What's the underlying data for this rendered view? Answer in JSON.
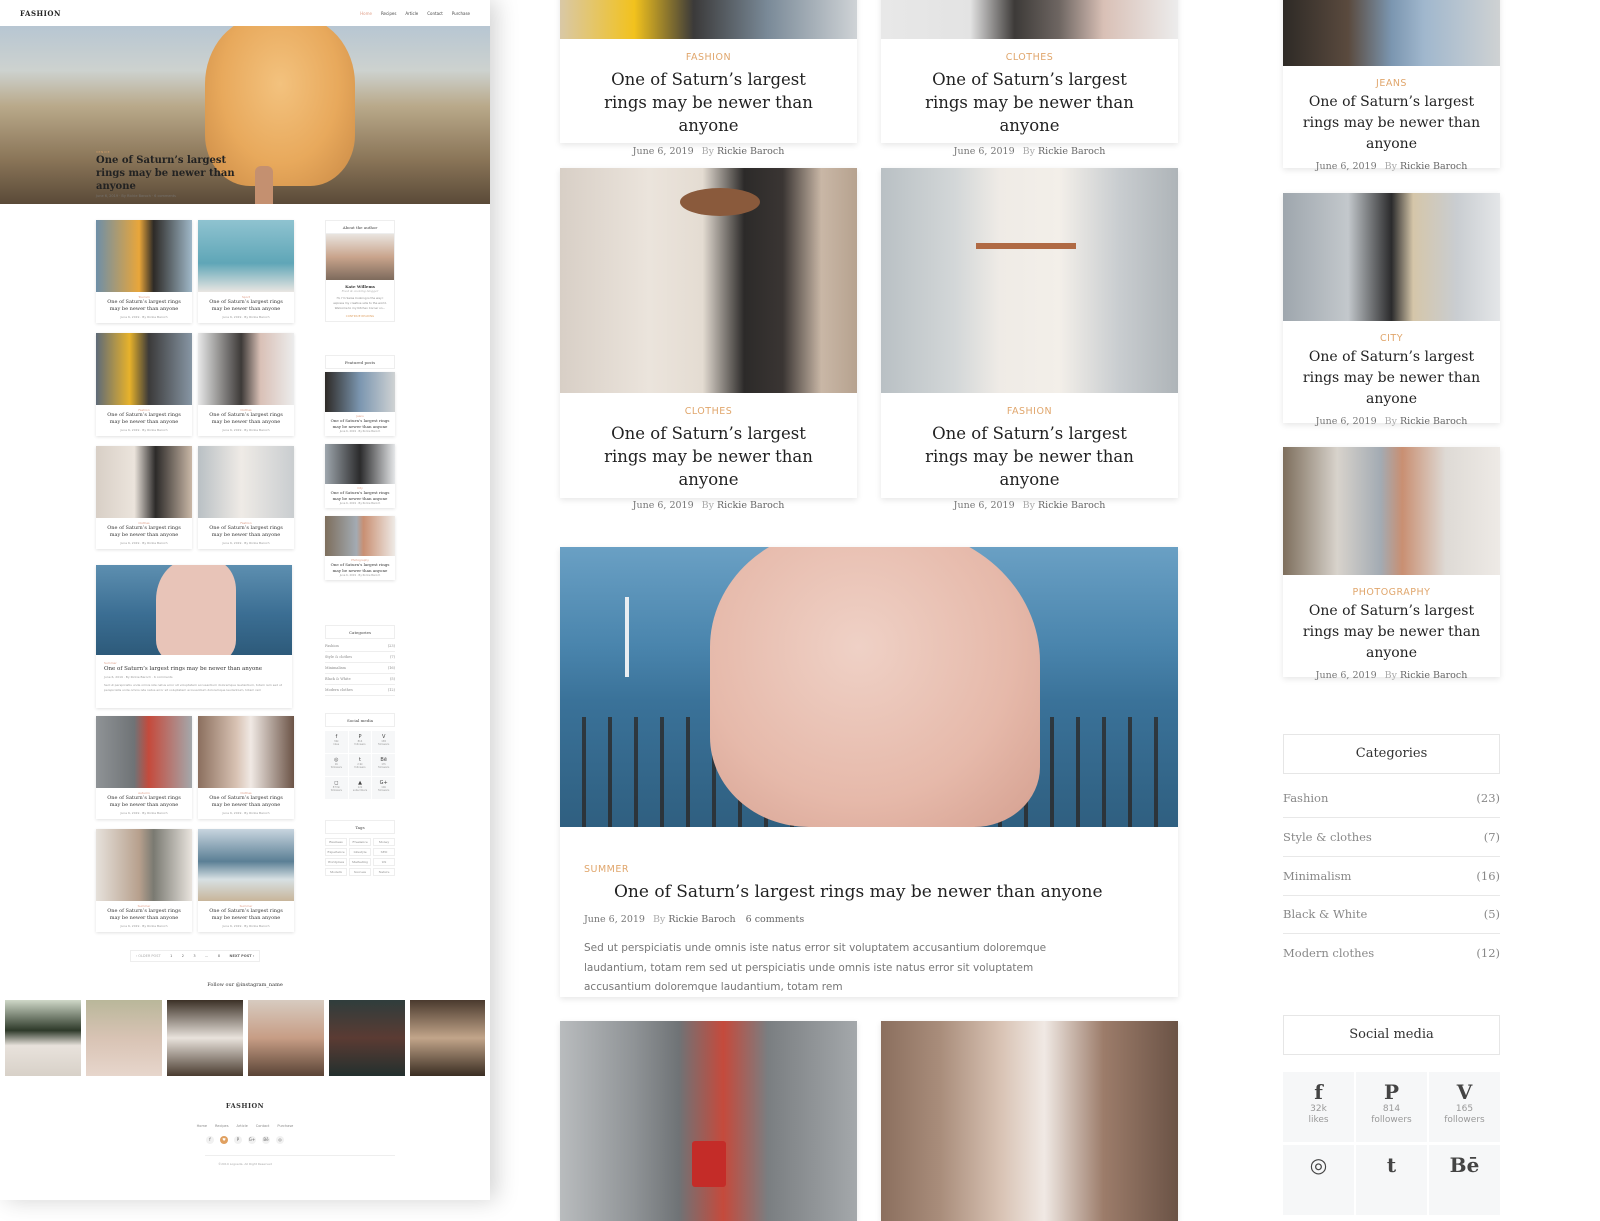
{
  "mini": {
    "logo": "FASHION",
    "menu": [
      "Home",
      "Recipes",
      "Article",
      "Contact",
      "Purchase"
    ],
    "hero": {
      "category": "VENICE",
      "title": "One of Saturn’s largest rings may be newer than anyone",
      "meta": "June 6, 2019  ·  By Rickie Baroch  ·  6 comments"
    },
    "cards": [
      {
        "category": "Tourism",
        "title": "One of Saturn’s largest rings may be newer than anyone",
        "meta": "June 6, 2019 · By Rickie Baroch"
      },
      {
        "category": "Sport",
        "title": "One of Saturn’s largest rings may be newer than anyone",
        "meta": "June 6, 2019 · By Rickie Baroch"
      },
      {
        "category": "Fashion",
        "title": "One of Saturn’s largest rings may be newer than anyone",
        "meta": "June 6, 2019 · By Rickie Baroch"
      },
      {
        "category": "Clothes",
        "title": "One of Saturn’s largest rings may be newer than anyone",
        "meta": "June 6, 2019 · By Rickie Baroch"
      },
      {
        "category": "Clothes",
        "title": "One of Saturn’s largest rings may be newer than anyone",
        "meta": "June 6, 2019 · By Rickie Baroch"
      },
      {
        "category": "Fashion",
        "title": "One of Saturn’s largest rings may be newer than anyone",
        "meta": "June 6, 2019 · By Rickie Baroch"
      },
      {
        "category": "Autumn",
        "title": "One of Saturn’s largest rings may be newer than anyone",
        "meta": "June 6, 2019 · By Rickie Baroch"
      },
      {
        "category": "Clothes",
        "title": "One of Saturn’s largest rings may be newer than anyone",
        "meta": "June 6, 2019 · By Rickie Baroch"
      },
      {
        "category": "Summer",
        "title": "One of Saturn’s largest rings may be newer than anyone",
        "meta": "June 6, 2019 · By Rickie Baroch"
      },
      {
        "category": "Summer",
        "title": "One of Saturn’s largest rings may be newer than anyone",
        "meta": "June 6, 2019 · By Rickie Baroch"
      }
    ],
    "wide": {
      "category": "Summer",
      "title": "One of Saturn’s largest rings may be newer than anyone",
      "meta": "June 6, 2019 · By Rickie Baroch · 6 comments",
      "excerpt": "Sed ut perspiciatis unde omnis iste natus error sit voluptatem accusantium doloremque laudantium, totam rem sed ut perspiciatis unde omnis iste natus error sit voluptatem accusantium doloremque laudantium, totam rem"
    },
    "about": {
      "heading": "About the author",
      "name": "Kate Willems",
      "role": "Food & cooking blogger",
      "bio": "Hi, I'm Swiss Cooking is the way I express my creative side to the world. Welcome to my Kitchen Corner on...",
      "link": "CONTINUE READING"
    },
    "featured": {
      "heading": "Featured posts",
      "items": [
        {
          "category": "Jeans",
          "title": "One of Saturn’s largest rings may be newer than anyone",
          "meta": "June 6, 2019 · By Rickie Baroch"
        },
        {
          "category": "City",
          "title": "One of Saturn’s largest rings may be newer than anyone",
          "meta": "June 6, 2019 · By Rickie Baroch"
        },
        {
          "category": "Photography",
          "title": "One of Saturn’s largest rings may be newer than anyone",
          "meta": "June 6, 2019 · By Rickie Baroch"
        }
      ]
    },
    "categories_heading": "Categories",
    "social_heading": "Social media",
    "social": [
      {
        "icon": "f",
        "count": "32k",
        "label": "likes"
      },
      {
        "icon": "P",
        "count": "814",
        "label": "followers"
      },
      {
        "icon": "V",
        "count": "165",
        "label": "followers"
      },
      {
        "icon": "◎",
        "count": "1K",
        "label": "followers"
      },
      {
        "icon": "t",
        "count": "2.9k",
        "label": "followers"
      },
      {
        "icon": "Bē",
        "count": "17k",
        "label": "followers"
      },
      {
        "icon": "◻",
        "count": "87mk",
        "label": "followers"
      },
      {
        "icon": "▲",
        "count": "12k",
        "label": "subscribers"
      },
      {
        "icon": "G+",
        "count": "14K",
        "label": "followers"
      }
    ],
    "tags_heading": "Tags",
    "tags": [
      "Business",
      "Freelance",
      "Money",
      "Experience",
      "Lifestyle",
      "SEO",
      "Wordpress",
      "Marketing",
      "UX",
      "Modern",
      "Success",
      "Nature"
    ],
    "pager": {
      "older": "‹ OLDER POST",
      "pages": [
        "1",
        "2",
        "3",
        "...",
        "8"
      ],
      "newer": "NEXT POST ›"
    },
    "instagram_title": "Follow our @instagram_name",
    "footer": {
      "logo": "FASHION",
      "menu": [
        "Home",
        "Recipes",
        "Article",
        "Contact",
        "Purchase"
      ],
      "social": [
        "f",
        "♥",
        "P",
        "G+",
        "Bē",
        "◎"
      ],
      "copyright": "©2019 Logoeda. All Right Reserved"
    }
  },
  "main": {
    "top_cards": [
      {
        "category": "FASHION",
        "title": "One of Saturn’s largest rings may be newer than anyone",
        "date": "June 6, 2019",
        "by": "By",
        "author": "Rickie Baroch"
      },
      {
        "category": "CLOTHES",
        "title": "One of Saturn’s largest rings may be newer than anyone",
        "date": "June 6, 2019",
        "by": "By",
        "author": "Rickie Baroch"
      }
    ],
    "mid_cards": [
      {
        "category": "CLOTHES",
        "title": "One of Saturn’s largest rings may be newer than anyone",
        "date": "June 6, 2019",
        "by": "By",
        "author": "Rickie Baroch"
      },
      {
        "category": "FASHION",
        "title": "One of Saturn’s largest rings may be newer than anyone",
        "date": "June 6, 2019",
        "by": "By",
        "author": "Rickie Baroch"
      }
    ],
    "wide": {
      "category": "SUMMER",
      "title": "One of Saturn’s largest rings may be newer than anyone",
      "date": "June 6, 2019",
      "by": "By",
      "author": "Rickie Baroch",
      "comments": "6 comments",
      "excerpt": "Sed ut perspiciatis unde omnis iste natus error sit voluptatem accusantium doloremque laudantium, totam rem sed ut perspiciatis unde omnis iste natus error sit voluptatem accusantium doloremque laudantium, totam rem"
    }
  },
  "sidebar": {
    "featured": [
      {
        "category": "JEANS",
        "title": "One of Saturn’s largest rings may be newer than anyone",
        "date": "June 6, 2019",
        "by": "By",
        "author": "Rickie Baroch"
      },
      {
        "category": "CITY",
        "title": "One of Saturn’s largest rings may be newer than anyone",
        "date": "June 6, 2019",
        "by": "By",
        "author": "Rickie Baroch"
      },
      {
        "category": "PHOTOGRAPHY",
        "title": "One of Saturn’s largest rings may be newer than anyone",
        "date": "June 6, 2019",
        "by": "By",
        "author": "Rickie Baroch"
      }
    ],
    "categories_heading": "Categories",
    "categories": [
      {
        "name": "Fashion",
        "count": "(23)"
      },
      {
        "name": "Style & clothes",
        "count": "(7)"
      },
      {
        "name": "Minimalism",
        "count": "(16)"
      },
      {
        "name": "Black & White",
        "count": "(5)"
      },
      {
        "name": "Modern clothes",
        "count": "(12)"
      }
    ],
    "social_heading": "Social media",
    "social": [
      {
        "icon": "f",
        "count": "32k",
        "label": "likes"
      },
      {
        "icon": "P",
        "count": "814",
        "label": "followers"
      },
      {
        "icon": "V",
        "count": "165",
        "label": "followers"
      },
      {
        "icon": "◎",
        "count": "",
        "label": ""
      },
      {
        "icon": "t",
        "count": "",
        "label": ""
      },
      {
        "icon": "Bē",
        "count": "",
        "label": ""
      }
    ]
  },
  "colors": {
    "accent": "#e0a66c",
    "text": "#222222",
    "muted": "#999999",
    "panel": "#f6f7f8"
  }
}
